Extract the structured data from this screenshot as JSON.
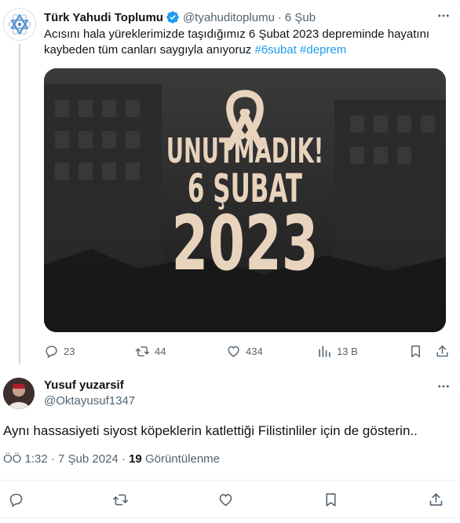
{
  "tweet": {
    "author_name": "Türk Yahudi Toplumu",
    "author_handle": "@tyahuditoplumu",
    "separator": "·",
    "date": "6 Şub",
    "text_plain": "Acısını hala yüreklerimizde  taşıdığımız 6 Şubat 2023 depreminde hayatını kaybeden tüm canları saygıyla anıyoruz ",
    "hashtag1": "#6subat",
    "hashtag2": "#deprem",
    "image": {
      "line1": "UNUTMADIK!",
      "line2": "6 ŞUBAT",
      "line3": "2023"
    },
    "stats": {
      "replies": "23",
      "retweets": "44",
      "likes": "434",
      "views": "13 B"
    }
  },
  "reply": {
    "author_name": "Yusuf yuzarsif",
    "author_handle": "@Oktayusuf1347",
    "text": "Aynı hassasiyeti siyost köpeklerin katlettiği Filistinliler için de gösterin..",
    "timestamp": "ÖÖ 1:32 · 7 Şub 2024 · ",
    "views_count": "19",
    "views_label": " Görüntülenme"
  },
  "colors": {
    "text": "#0f1419",
    "muted": "#536471",
    "accent": "#1d9bf0",
    "ribbon": "#e8d3bd"
  },
  "icons": {
    "verified": "verified-badge-icon",
    "more": "more-horizontal-icon",
    "reply": "reply-icon",
    "retweet": "retweet-icon",
    "like": "heart-icon",
    "views": "views-chart-icon",
    "bookmark": "bookmark-icon",
    "share": "share-icon"
  }
}
